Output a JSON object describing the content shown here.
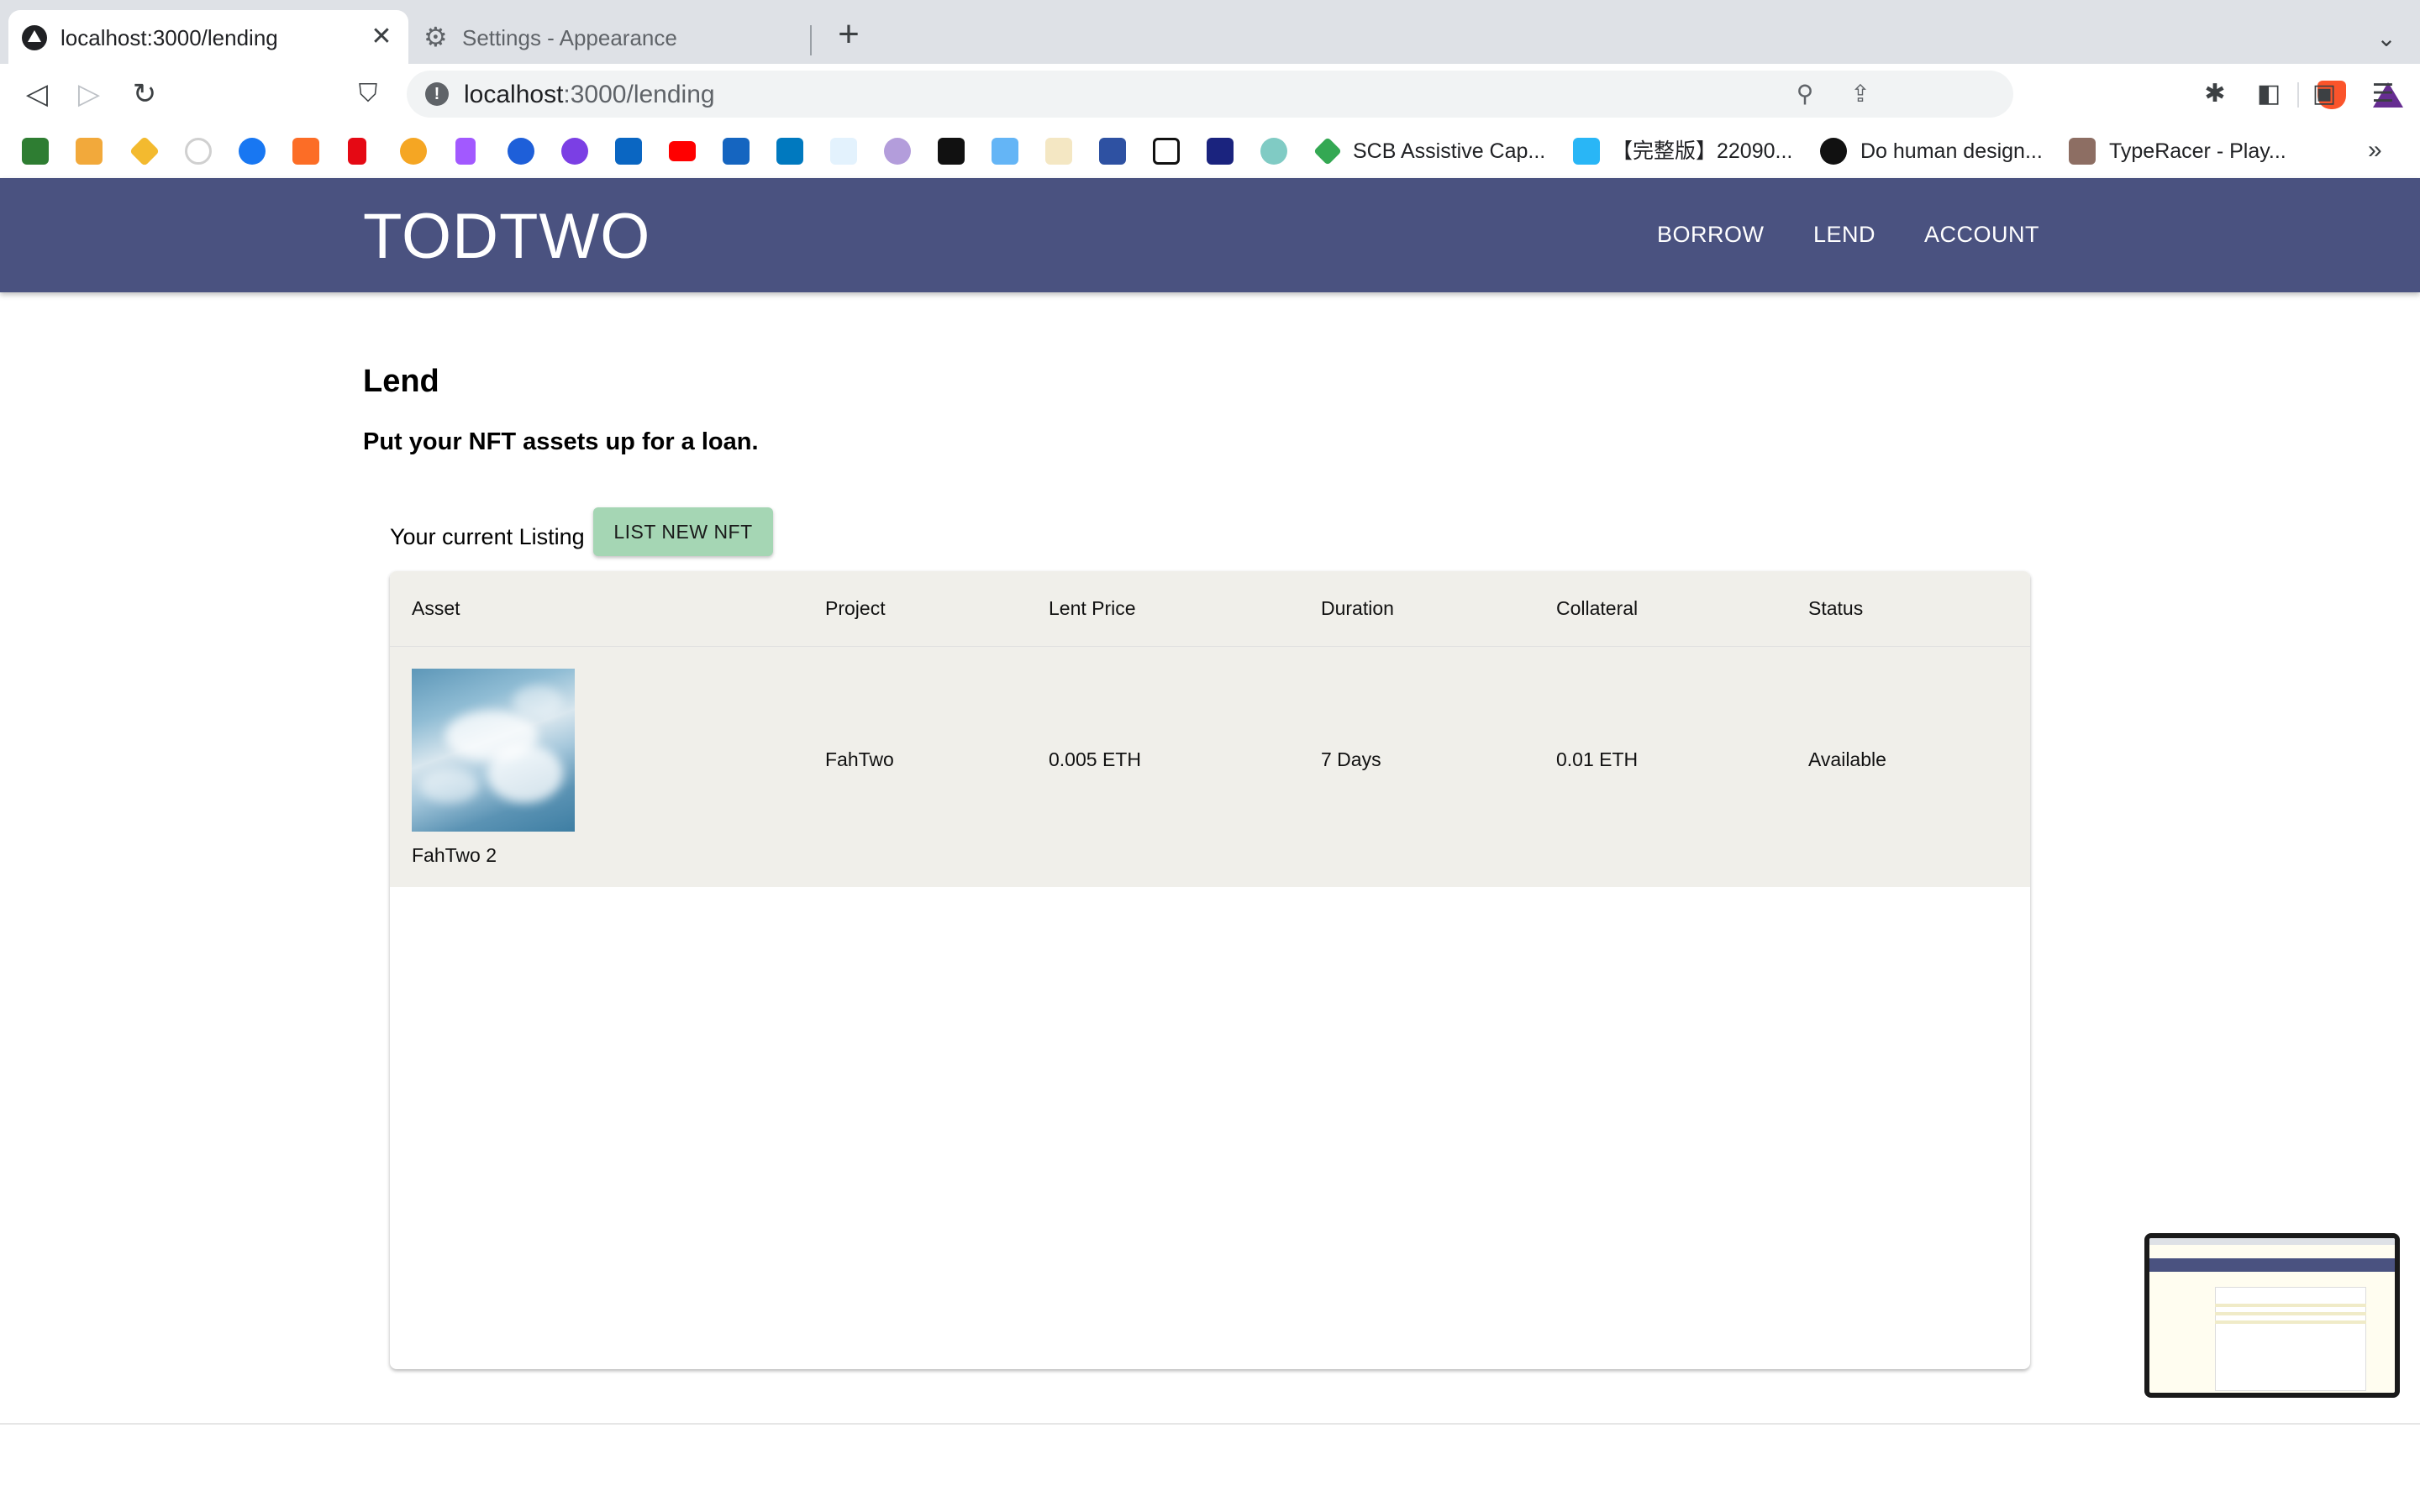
{
  "browser": {
    "tabs": [
      {
        "title": "localhost:3000/lending",
        "active": true
      },
      {
        "title": "Settings - Appearance",
        "active": false
      }
    ],
    "address": {
      "host": "localhost",
      "rest": ":3000/lending"
    },
    "bookmarks": [
      {
        "label": "SCB Assistive Cap..."
      },
      {
        "label": "【完整版】22090..."
      },
      {
        "label": "Do human design..."
      },
      {
        "label": "TypeRacer - Play..."
      }
    ],
    "more_glyph": "»"
  },
  "app": {
    "logo": "TODTWO",
    "nav": {
      "borrow": "BORROW",
      "lend": "LEND",
      "account": "ACCOUNT"
    },
    "header_color": "#4a5280"
  },
  "page": {
    "title": "Lend",
    "subtitle": "Put your NFT assets up for a loan.",
    "listing_label": "Your current Listing",
    "list_button": "LIST NEW NFT",
    "accent_button_color": "#a5d6b4"
  },
  "table": {
    "headers": {
      "asset": "Asset",
      "project": "Project",
      "lent_price": "Lent Price",
      "duration": "Duration",
      "collateral": "Collateral",
      "status": "Status"
    },
    "rows": [
      {
        "asset_name": "FahTwo 2",
        "project": "FahTwo",
        "lent_price": "0.005 ETH",
        "duration": "7 Days",
        "collateral": "0.01 ETH",
        "status": "Available"
      }
    ]
  }
}
